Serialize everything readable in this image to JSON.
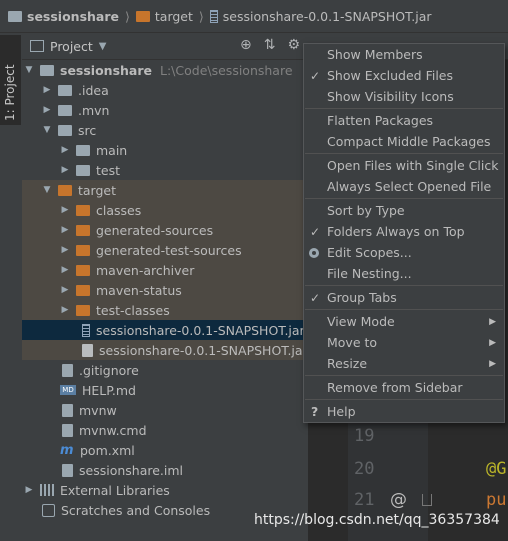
{
  "breadcrumb": {
    "items": [
      "sessionshare",
      "target",
      "sessionshare-0.0.1-SNAPSHOT.jar"
    ]
  },
  "toolstrip": {
    "tab_label": "1: Project"
  },
  "project_panel": {
    "title": "Project",
    "header_icons": [
      "locate-icon",
      "collapse-icon",
      "gear-icon"
    ]
  },
  "tree": {
    "root": {
      "label": "sessionshare",
      "path": "L:\\Code\\sessionshare"
    },
    "idea": ".idea",
    "mvn": ".mvn",
    "src": "src",
    "main": "main",
    "test": "test",
    "target": "target",
    "classes": "classes",
    "generated_sources": "generated-sources",
    "generated_test_sources": "generated-test-sources",
    "maven_archiver": "maven-archiver",
    "maven_status": "maven-status",
    "test_classes": "test-classes",
    "jar": "sessionshare-0.0.1-SNAPSHOT.jar",
    "jar_original": "sessionshare-0.0.1-SNAPSHOT.jar.o",
    "gitignore": ".gitignore",
    "help": "HELP.md",
    "mvnw": "mvnw",
    "mvnw_cmd": "mvnw.cmd",
    "pom": "pom.xml",
    "iml": "sessionshare.iml",
    "external_libraries": "External Libraries",
    "scratches": "Scratches and Consoles",
    "md_badge": "MD"
  },
  "menu": {
    "show_members": "Show Members",
    "show_excluded_files": "Show Excluded Files",
    "show_visibility_icons": "Show Visibility Icons",
    "flatten_packages": "Flatten Packages",
    "compact_middle_packages": "Compact Middle Packages",
    "open_files_single_click": "Open Files with Single Click",
    "always_select_opened_file": "Always Select Opened File",
    "sort_by_type": "Sort by Type",
    "folders_always_on_top": "Folders Always on Top",
    "edit_scopes": "Edit Scopes...",
    "file_nesting": "File Nesting...",
    "group_tabs": "Group Tabs",
    "view_mode": "View Mode",
    "move_to": "Move to",
    "resize": "Resize",
    "remove_from_sidebar": "Remove from Sidebar",
    "help": "Help",
    "check_glyph": "✓",
    "submenu_glyph": "▶",
    "help_glyph": "?"
  },
  "editor": {
    "line_19": "19",
    "line_20": "20",
    "line_21": "21",
    "annotation_fragment": "@G",
    "keyword_fragment": "pu",
    "at_glyph": "@"
  },
  "watermark": "https://blog.csdn.net/qq_36357384",
  "colors": {
    "panel_bg": "#3c3f41",
    "editor_bg": "#2b2b2b",
    "selection": "#0d293e",
    "excluded_highlight": "#4d4943",
    "excluded_folder": "#c7752c"
  }
}
